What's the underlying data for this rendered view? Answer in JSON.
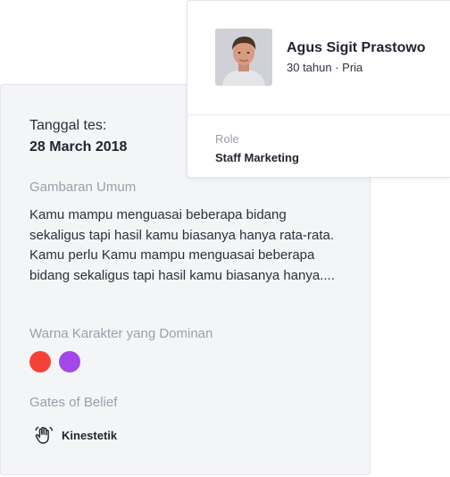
{
  "report": {
    "test_date_label": "Tanggal tes:",
    "test_date_value": "28 March 2018",
    "overview_heading": "Gambaran Umum",
    "overview_text": "Kamu mampu menguasai beberapa bidang sekaligus tapi hasil kamu biasanya hanya rata-rata. Kamu perlu Kamu mampu menguasai beberapa bidang sekaligus tapi hasil kamu biasanya hanya....",
    "dominant_colors_heading": "Warna Karakter yang Dominan",
    "dominant_colors": [
      "#f44336",
      "#a347e8"
    ],
    "gates_heading": "Gates of Belief",
    "gate": {
      "icon": "hand-wave-icon",
      "label": "Kinestetik"
    }
  },
  "profile": {
    "name": "Agus Sigit Prastowo",
    "meta": "30 tahun · Pria",
    "role_label": "Role",
    "role_value": "Staff Marketing"
  }
}
